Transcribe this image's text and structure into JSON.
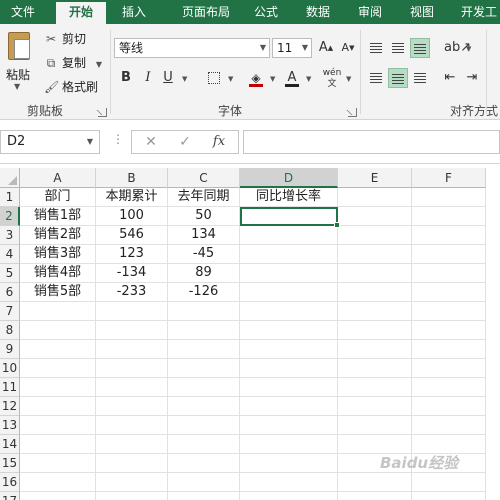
{
  "tabs": [
    "文件",
    "开始",
    "插入",
    "页面布局",
    "公式",
    "数据",
    "审阅",
    "视图",
    "开发工"
  ],
  "active_tab": 1,
  "ribbon": {
    "clipboard": {
      "paste": "粘贴",
      "cut": "剪切",
      "copy": "复制",
      "format_painter": "格式刷",
      "group_label": "剪贴板"
    },
    "font": {
      "font_name": "等线",
      "font_size": "11",
      "bold": "B",
      "italic": "I",
      "underline": "U",
      "font_color_letter": "A",
      "group_label": "字体"
    },
    "alignment": {
      "group_label": "对齐方式"
    }
  },
  "formula_bar": {
    "name_box": "D2",
    "cancel": "✕",
    "enter": "✓",
    "fx": "fx",
    "formula": ""
  },
  "sheet": {
    "columns": [
      "A",
      "B",
      "C",
      "D",
      "E",
      "F"
    ],
    "rows": [
      "1",
      "2",
      "3",
      "4",
      "5",
      "6",
      "7",
      "8",
      "9",
      "10",
      "11",
      "12",
      "13",
      "14",
      "15",
      "16",
      "17"
    ],
    "cells": {
      "A1": "部门",
      "B1": "本期累计",
      "C1": "去年同期",
      "D1": "同比增长率",
      "A2": "销售1部",
      "B2": "100",
      "C2": "50",
      "A3": "销售2部",
      "B3": "546",
      "C3": "134",
      "A4": "销售3部",
      "B4": "123",
      "C4": "-45",
      "A5": "销售4部",
      "B5": "-134",
      "C5": "89",
      "A6": "销售5部",
      "B6": "-233",
      "C6": "-126"
    },
    "selected_cell": "D2"
  },
  "colors": {
    "accent": "#217346",
    "font_color_underline": "#c00000",
    "highlight_fill": "#ffff00"
  },
  "watermark": "Baidu经验"
}
